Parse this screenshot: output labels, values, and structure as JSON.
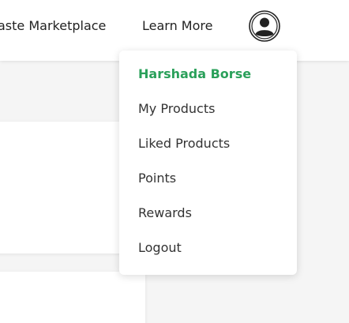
{
  "navbar": {
    "links": [
      "aste Marketplace",
      "Learn More"
    ]
  },
  "user_menu": {
    "avatar_icon": "user-circle-icon",
    "user_name": "Harshada Borse",
    "user_name_color": "#2aa05a",
    "items": [
      "My Products",
      "Liked Products",
      "Points",
      "Rewards",
      "Logout"
    ]
  }
}
